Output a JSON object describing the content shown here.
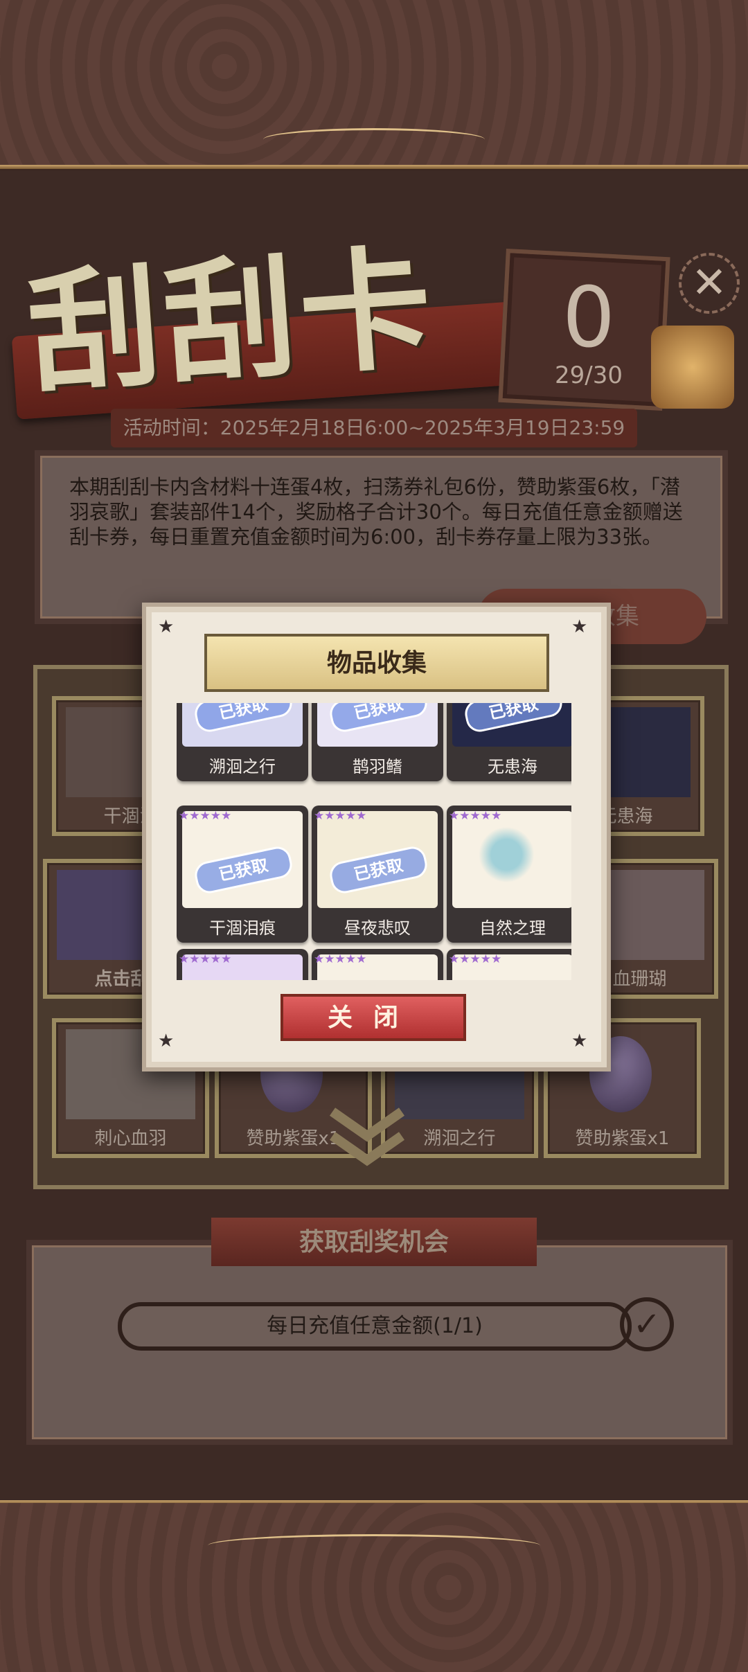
{
  "header": {
    "title": "刮刮卡",
    "counter_value": "0",
    "counter_progress": "29/30",
    "close_icon": "✕"
  },
  "event": {
    "date_label": "活动时间：2025年2月18日6:00~2025年3月19日23:59",
    "description": "本期刮刮卡内含材料十连蛋4枚，扫荡券礼包6份，赞助紫蛋6枚，「潜羽哀歌」套装部件14个，奖励格子合计30个。每日充值任意金额赠送刮卡券，每日重置充值金额时间为6:00，刮卡券存量上限为33张。",
    "collection_button": "物品收集"
  },
  "grid": {
    "cells": [
      {
        "label": "干涸泪"
      },
      {
        "label": "无患海"
      },
      {
        "label": "点击刮"
      },
      {
        "label": "血珊瑚"
      },
      {
        "label": "刺心血羽"
      },
      {
        "label": "赞助紫蛋x1"
      },
      {
        "label": "溯洄之行"
      },
      {
        "label": "赞助紫蛋x1"
      }
    ]
  },
  "chance": {
    "title": "获取刮奖机会",
    "task_label": "每日充值任意金额(1/1)",
    "check_icon": "✓"
  },
  "modal": {
    "title": "物品收集",
    "obtained_stamp": "已获取",
    "items": [
      {
        "name": "溯洄之行",
        "obtained": true
      },
      {
        "name": "鹊羽鳍",
        "obtained": true
      },
      {
        "name": "无患海",
        "obtained": true
      },
      {
        "name": "干涸泪痕",
        "obtained": true
      },
      {
        "name": "昼夜悲叹",
        "obtained": true
      },
      {
        "name": "自然之理",
        "obtained": false
      },
      {
        "name": "",
        "obtained": false
      },
      {
        "name": "",
        "obtained": false
      },
      {
        "name": "",
        "obtained": false
      }
    ],
    "close_button": "关闭"
  },
  "colors": {
    "accent_red": "#c84040",
    "gold": "#c9a36b",
    "stamp_blue": "#7896e6",
    "star_purple": "#a06ad0"
  }
}
